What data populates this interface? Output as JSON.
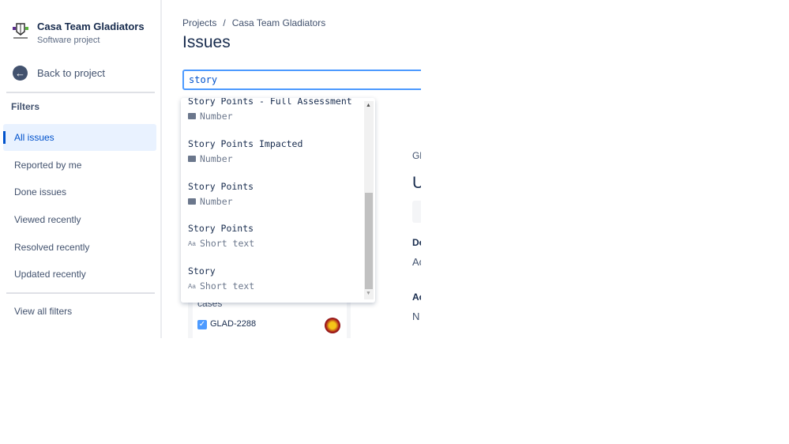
{
  "sidebar": {
    "project_name": "Casa Team Gladiators",
    "project_type": "Software project",
    "back_label": "Back to project",
    "filters_heading": "Filters",
    "items": [
      {
        "label": "All issues",
        "active": true
      },
      {
        "label": "Reported by me"
      },
      {
        "label": "Done issues"
      },
      {
        "label": "Viewed recently"
      },
      {
        "label": "Resolved recently"
      },
      {
        "label": "Updated recently"
      }
    ],
    "view_all": "View all filters"
  },
  "breadcrumb": {
    "root": "Projects",
    "separator": "/",
    "current": "Casa Team Gladiators"
  },
  "page_title": "Issues",
  "search": {
    "value": "story"
  },
  "dropdown": {
    "options": [
      {
        "name": "Story Points - Full Assessment",
        "type": "Number",
        "icon": "number-icon"
      },
      {
        "name": "Story Points Impacted",
        "type": "Number",
        "icon": "number-icon"
      },
      {
        "name": "Story Points",
        "type": "Number",
        "icon": "number-icon"
      },
      {
        "name": "Story Points",
        "type": "Short text",
        "icon": "text-icon"
      },
      {
        "name": "Story",
        "type": "Short text",
        "icon": "text-icon"
      }
    ]
  },
  "list": {
    "partial_text": "cases",
    "issue_key": "GLAD-2288"
  },
  "detail": {
    "key_partial": "Gl",
    "title_partial": "U",
    "desc_heading_partial": "De",
    "desc_partial": "Ac",
    "act_heading_partial": "Ac",
    "act_partial": "N"
  },
  "colors": {
    "accent": "#0052cc",
    "focus": "#4c9aff",
    "active_bg": "#e9f2ff"
  }
}
